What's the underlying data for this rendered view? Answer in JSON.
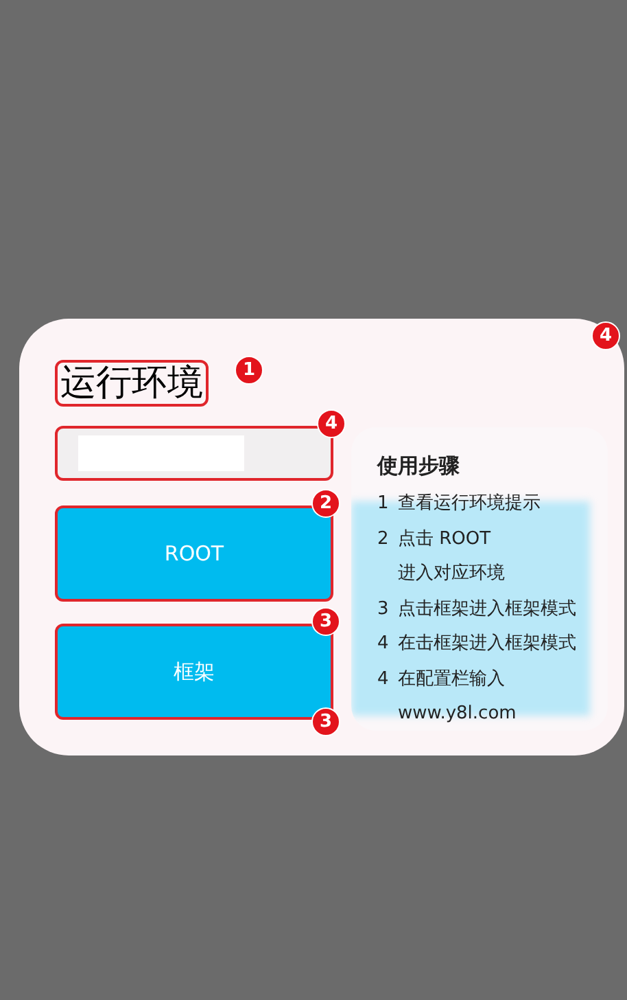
{
  "card": {
    "badge": "4"
  },
  "title": {
    "text": "运行环境",
    "badge": "1"
  },
  "input": {
    "badge": "4"
  },
  "buttons": [
    {
      "label": "ROOT",
      "badges": [
        "2"
      ]
    },
    {
      "label": "框架",
      "badges": [
        "3",
        "3"
      ]
    }
  ],
  "steps": {
    "title": "使用步骤",
    "lines": [
      {
        "number": "1",
        "text": "查看运行环境提示"
      },
      {
        "number": "2",
        "text": "点击 ROOT"
      },
      {
        "text": "进入对应环境"
      },
      {
        "number": "3",
        "text": "点击框架进入框架模式"
      },
      {
        "number": "4",
        "text": "在击框架进入框架模式"
      },
      {
        "number": "4",
        "text": "在配置栏输入"
      },
      {
        "text": "www.y8l.com"
      }
    ]
  }
}
